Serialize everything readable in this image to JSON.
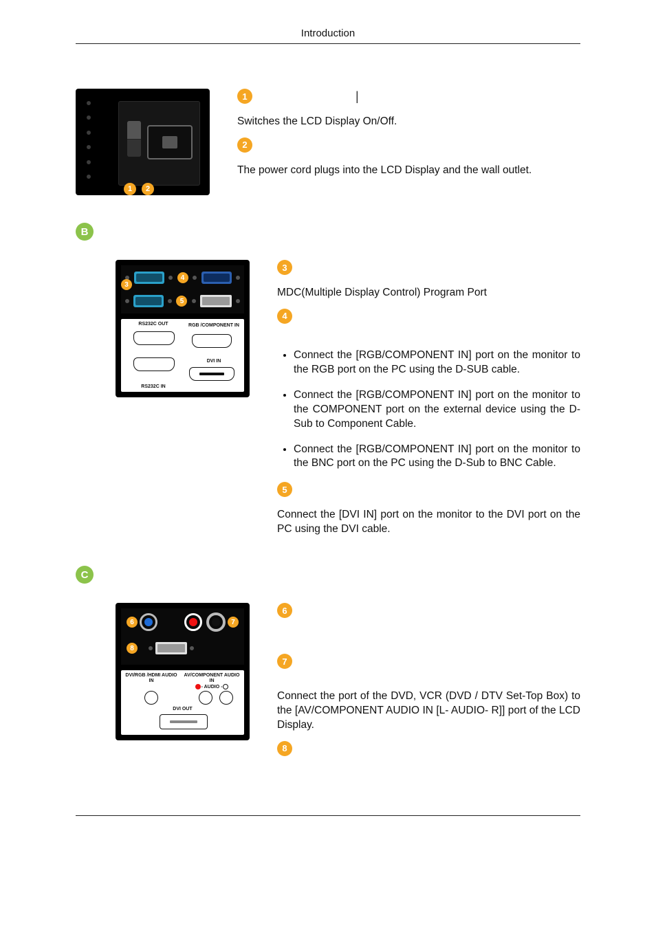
{
  "header": {
    "title": "Introduction"
  },
  "section_a": {
    "item1_desc": "Switches the LCD Display On/Off.",
    "item2_desc": "The power cord plugs into the LCD Display and the wall outlet."
  },
  "section_b": {
    "letter": "B",
    "panel": {
      "label_rs232c_out": "RS232C OUT",
      "label_rgb_comp_in": "RGB /COMPONENT IN",
      "label_dvi_in": "DVI IN",
      "label_rs232c_in": "RS232C IN"
    },
    "item3_desc": "MDC(Multiple Display Control) Program Port",
    "bullets": [
      "Connect the [RGB/COMPONENT IN] port on the monitor to the RGB port on the PC using the D-SUB cable.",
      "Connect the [RGB/COMPONENT IN] port on the monitor to the COMPONENT port on the external device using the D-Sub to Component Cable.",
      "Connect the [RGB/COMPONENT IN] port on the monitor to the BNC port on the PC using the D-Sub to BNC Cable."
    ],
    "item5_desc": "Connect the [DVI IN] port on the monitor to the DVI port on the PC using the DVI cable."
  },
  "section_c": {
    "letter": "C",
    "panel": {
      "label_dvi_rgb_hdmi": "DVI/RGB /HDMI AUDIO IN",
      "label_av_comp_audio": "AV/COMPONENT AUDIO IN",
      "label_audio_lr": "- AUDIO -",
      "label_dvi_out": "DVI OUT"
    },
    "item7_desc": "Connect the port of the DVD, VCR (DVD / DTV Set-Top Box) to the [AV/COMPONENT AUDIO IN [L- AUDIO- R]] port of the LCD Display."
  },
  "numbers": {
    "n1": "1",
    "n2": "2",
    "n3": "3",
    "n4": "4",
    "n5": "5",
    "n6": "6",
    "n7": "7",
    "n8": "8"
  }
}
